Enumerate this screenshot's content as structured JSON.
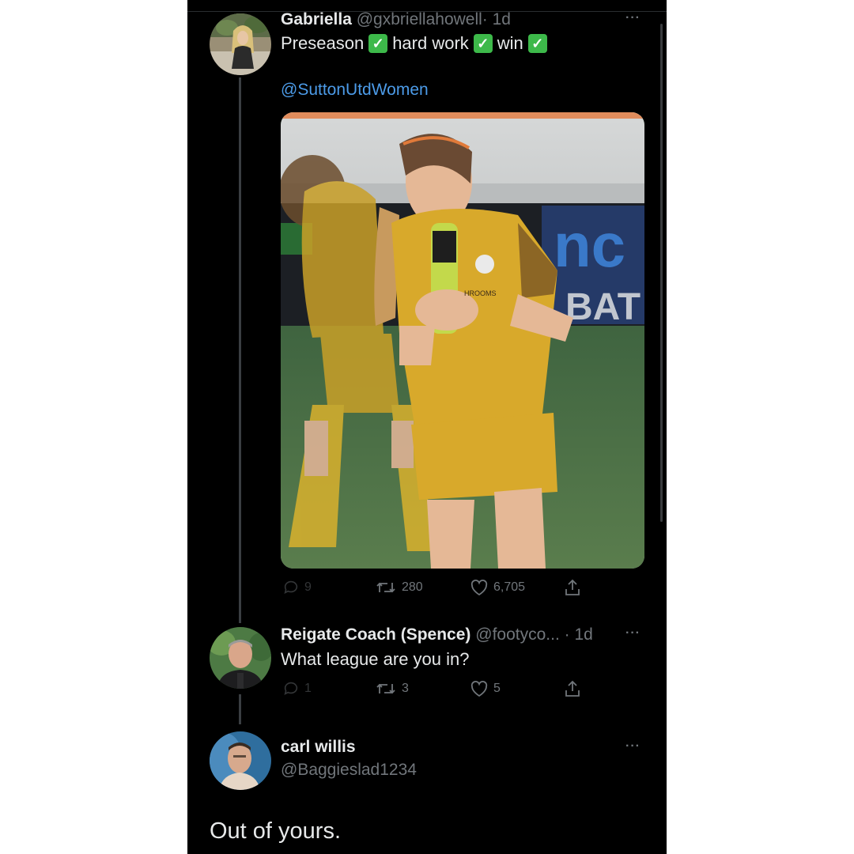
{
  "tweet1": {
    "name": "Gabriella",
    "handle": "@gxbriellahowell",
    "time": "· 1d",
    "text_parts": [
      "Preseason",
      "hard work",
      "win"
    ],
    "check_glyph": "✓",
    "mention": "@SuttonUtdWomen",
    "sign_text": "nc",
    "sign_text2": "BAT",
    "kit_sponsor": "HROOMS",
    "stats": {
      "replies": "9",
      "retweets": "280",
      "likes": "6,705"
    }
  },
  "tweet2": {
    "name": "Reigate Coach (Spence)",
    "handle": "@footyco...",
    "time": "· 1d",
    "text": "What league are you in?",
    "stats": {
      "replies": "1",
      "retweets": "3",
      "likes": "5"
    }
  },
  "tweet3": {
    "name": "carl willis",
    "handle": "@Baggieslad1234",
    "text": "Out of yours."
  },
  "more_glyph": "···",
  "colors": {
    "background": "#000000",
    "text": "#e7e9ea",
    "secondary": "#71767b",
    "link": "#4c9be8",
    "check": "#3db94a"
  },
  "icons": [
    "reply-icon",
    "retweet-icon",
    "like-icon",
    "share-icon",
    "more-icon",
    "check-icon"
  ]
}
